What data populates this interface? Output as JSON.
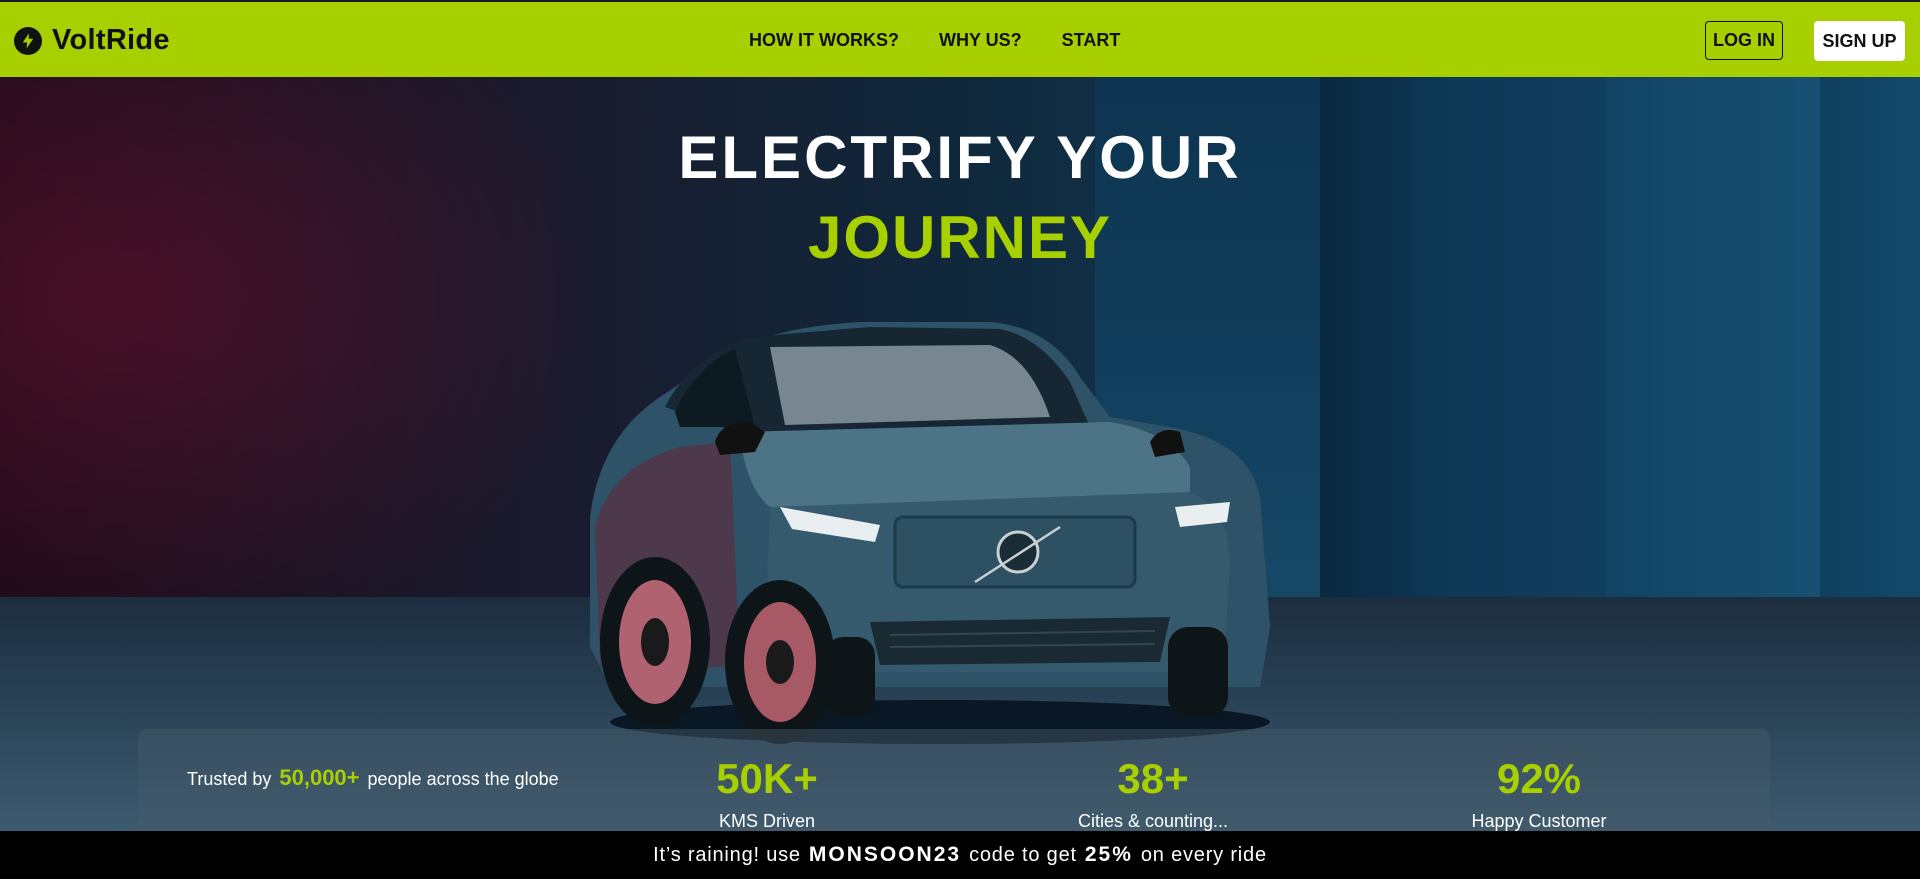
{
  "brand": {
    "name": "VoltRide",
    "icon": "lightning-bolt-icon"
  },
  "nav": {
    "links": [
      "HOW IT WORKS?",
      "WHY US?",
      "START"
    ],
    "login_label": "LOG IN",
    "signup_label": "SIGN UP"
  },
  "hero": {
    "title_line1": "ELECTRIFY YOUR",
    "title_line2": "JOURNEY"
  },
  "stats": {
    "trusted_prefix": "Trusted by",
    "trusted_count": "50,000+",
    "trusted_suffix": "people across the globe",
    "items": [
      {
        "value": "50K+",
        "label": "KMS Driven"
      },
      {
        "value": "38+",
        "label": "Cities & counting..."
      },
      {
        "value": "92%",
        "label": "Happy Customer"
      }
    ]
  },
  "promo": {
    "prefix": "It’s raining! use",
    "code": "MONSOON23",
    "middle": "code to get",
    "discount": "25%",
    "suffix": "on every ride"
  },
  "colors": {
    "accent": "#a8cf00",
    "nav_bg": "#a8cf00",
    "promo_bg": "#000000"
  }
}
